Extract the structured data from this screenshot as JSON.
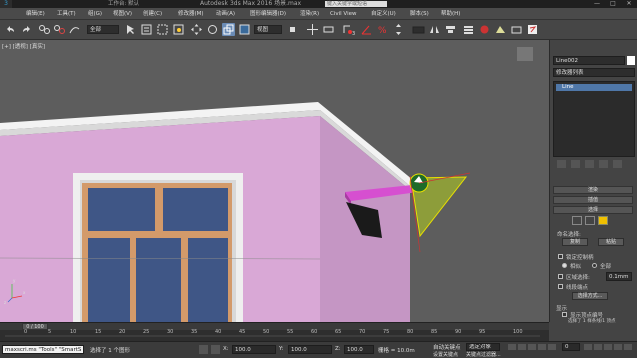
{
  "window": {
    "title": "Autodesk 3ds Max 2016    场景.max",
    "workspace_label": "工作台: 默认",
    "search_placeholder": "键入关键字或短语",
    "minimize": "—",
    "maximize": "□",
    "close": "✕"
  },
  "menu": {
    "items": [
      "编辑(E)",
      "工具(T)",
      "组(G)",
      "视图(V)",
      "创建(C)",
      "修改器(M)",
      "动画(A)",
      "图形编辑器(D)",
      "渲染(R)",
      "Civil View",
      "自定义(U)",
      "脚本(S)",
      "帮助(H)"
    ]
  },
  "toolbar": {
    "filter_value": "全部",
    "viewport_select_value": "视图",
    "snap_counts": [
      "3",
      "2",
      "%",
      "n"
    ],
    "icons": [
      "undo-icon",
      "redo-icon",
      "link-icon",
      "unlink-icon",
      "bind-spacewarp-icon",
      "filter-dropdown",
      "select-object-icon",
      "select-by-name-icon",
      "rect-select-icon",
      "window-crossing-icon",
      "select-move-icon",
      "select-rotate-icon",
      "select-scale-icon",
      "coordinate-dropdown",
      "pivot-icon",
      "manipulate-icon",
      "keyboard-shortcut-icon",
      "snap-toggle-icon",
      "angle-snap-icon",
      "percent-snap-icon",
      "spinner-snap-icon",
      "named-selection-icon",
      "mirror-icon",
      "align-icon"
    ]
  },
  "viewport": {
    "label": "[+] [透视] [真实]",
    "axis_x": "x",
    "axis_y": "y",
    "axis_z": "z"
  },
  "command_panel": {
    "tab_icons": [
      "create-icon",
      "modify-icon",
      "hierarchy-icon",
      "motion-icon",
      "display-icon",
      "utilities-icon"
    ],
    "object_name": "Line002",
    "modifier_list": "修改器列表",
    "stack_items": [
      "Line"
    ],
    "rollouts": [
      "渲染",
      "插值",
      "选择"
    ],
    "named_selections_label": "命名选择:",
    "copy_button": "复制",
    "paste_button": "粘贴",
    "lock_handles": "锁定控制柄",
    "similar": "相似",
    "all": "全部",
    "area_selection": "区域选择:",
    "area_value": "0.1mm",
    "segment_end": "线段端点",
    "select_by": "选择方式...",
    "display_label": "显示",
    "show_vertex_numbers": "显示顶点编号",
    "selected_only": "仅选定",
    "status_text": "选择了 1 样条线/1 顶点"
  },
  "timeline": {
    "slider_text": "0 / 100",
    "ticks": [
      "0",
      "5",
      "10",
      "15",
      "20",
      "25",
      "30",
      "35",
      "40",
      "45",
      "50",
      "55",
      "60",
      "65",
      "70",
      "75",
      "80",
      "85",
      "90",
      "95",
      "100"
    ]
  },
  "status": {
    "script_listener": "maxscri.ms \"Tools\"  \"SmartS",
    "prompt": "选择了 1 个图形",
    "x_label": "X:",
    "x_value": "100.0",
    "y_label": "Y:",
    "y_value": "100.0",
    "z_label": "Z:",
    "z_value": "100.0",
    "grid_label": "栅格 = 10.0m",
    "auto_key": "自动关键点",
    "selected_label": "选定对象",
    "set_key": "设置关键点",
    "key_filters": "关键点过滤器...",
    "frame_value": "0"
  }
}
